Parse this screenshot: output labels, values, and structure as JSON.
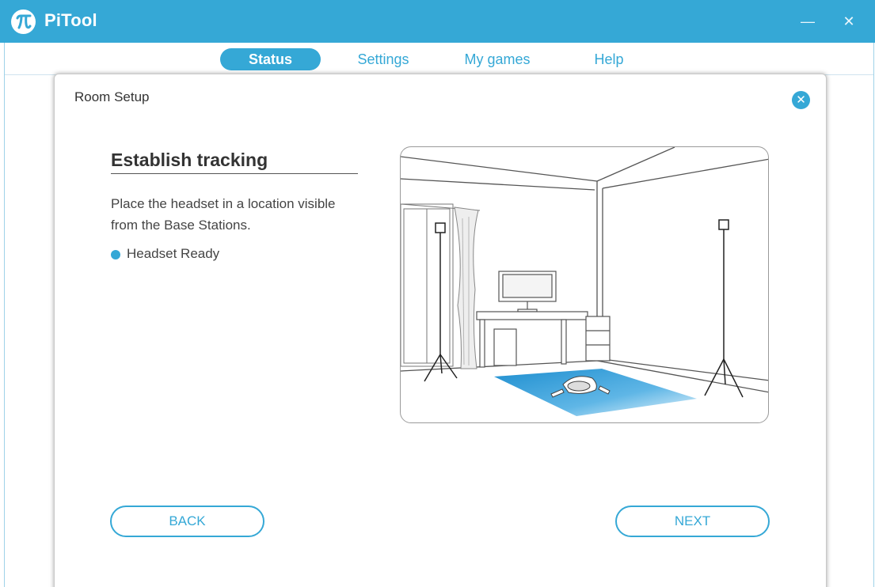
{
  "app": {
    "title": "PiTool",
    "logo_icon": "pi-logo-icon"
  },
  "window_controls": {
    "minimize_glyph": "—",
    "close_glyph": "✕"
  },
  "nav": {
    "tabs": [
      {
        "label": "Status",
        "active": true
      },
      {
        "label": "Settings",
        "active": false
      },
      {
        "label": "My games",
        "active": false
      },
      {
        "label": "Help",
        "active": false
      }
    ]
  },
  "dialog": {
    "title": "Room Setup",
    "close_glyph": "✕",
    "heading": "Establish tracking",
    "instructions": "Place the headset in a location visible from the Base Stations.",
    "status": {
      "label": "Headset Ready",
      "color": "#35a8d6"
    },
    "illustration_icon": "room-setup-illustration",
    "back_label": "BACK",
    "next_label": "NEXT"
  },
  "colors": {
    "accent": "#35a8d6",
    "text": "#333333"
  }
}
